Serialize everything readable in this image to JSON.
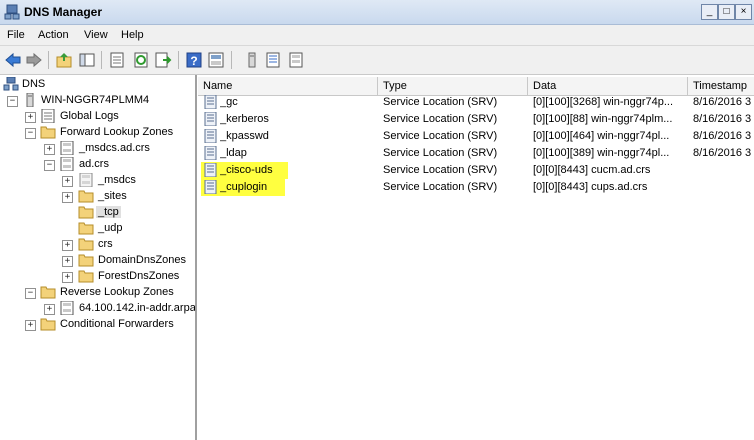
{
  "window": {
    "title": "DNS Manager",
    "minimize": "_",
    "maximize": "□",
    "close": "×"
  },
  "menu": [
    "File",
    "Action",
    "View",
    "Help"
  ],
  "tree": {
    "root": "DNS",
    "server": "WIN-NGGR74PLMM4",
    "global_logs": "Global Logs",
    "forward": "Forward Lookup Zones",
    "msdcs_zone": "_msdcs.ad.crs",
    "adcrs": "ad.crs",
    "msdcs": "_msdcs",
    "sites": "_sites",
    "tcp": "_tcp",
    "udp": "_udp",
    "crs": "crs",
    "domaindns": "DomainDnsZones",
    "forestdns": "ForestDnsZones",
    "reverse": "Reverse Lookup Zones",
    "inaddr": "64.100.142.in-addr.arpa",
    "conditional": "Conditional Forwarders"
  },
  "columns": {
    "name": "Name",
    "type": "Type",
    "data": "Data",
    "timestamp": "Timestamp"
  },
  "records": [
    {
      "name": "_gc",
      "type": "Service Location (SRV)",
      "data": "[0][100][3268] win-nggr74p...",
      "timestamp": "8/16/2016 3",
      "highlighted": false
    },
    {
      "name": "_kerberos",
      "type": "Service Location (SRV)",
      "data": "[0][100][88] win-nggr74plm...",
      "timestamp": "8/16/2016 3",
      "highlighted": false
    },
    {
      "name": "_kpasswd",
      "type": "Service Location (SRV)",
      "data": "[0][100][464] win-nggr74pl...",
      "timestamp": "8/16/2016 3",
      "highlighted": false
    },
    {
      "name": "_ldap",
      "type": "Service Location (SRV)",
      "data": "[0][100][389] win-nggr74pl...",
      "timestamp": "8/16/2016 3",
      "highlighted": false
    },
    {
      "name": "_cisco-uds",
      "type": "Service Location (SRV)",
      "data": "[0][0][8443] cucm.ad.crs",
      "timestamp": "",
      "highlighted": true
    },
    {
      "name": "_cuplogin",
      "type": "Service Location (SRV)",
      "data": "[0][0][8443] cups.ad.crs",
      "timestamp": "",
      "highlighted": true
    }
  ],
  "colors": {
    "highlight": "#ffff40",
    "folder": "#f3d27a",
    "title_bar": "#c9d9ee"
  }
}
